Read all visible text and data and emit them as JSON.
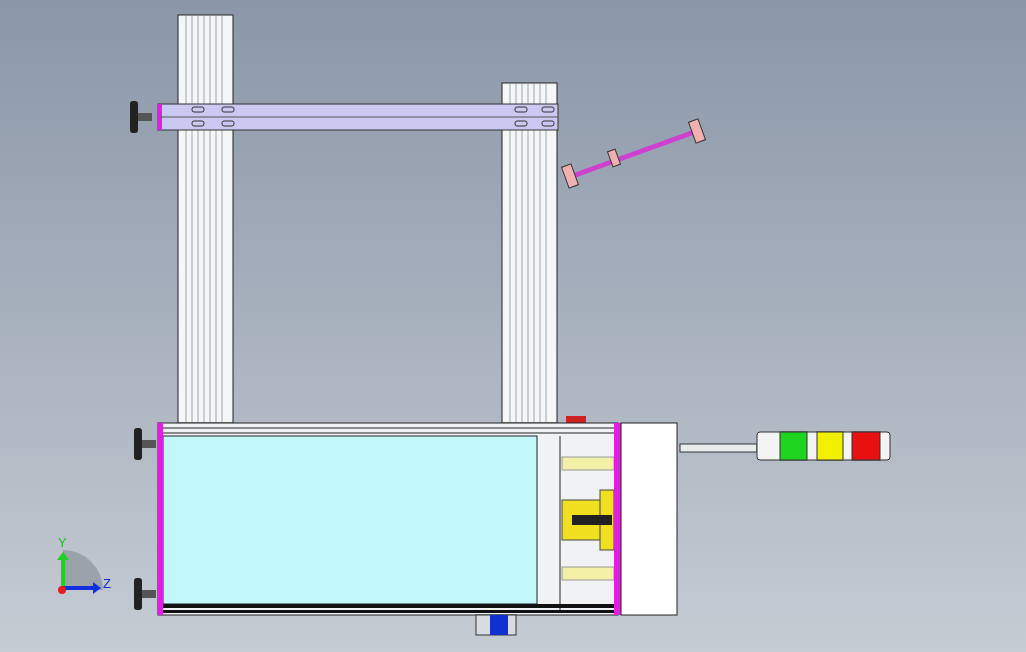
{
  "viewport": {
    "triad": {
      "axes": [
        {
          "kind": "y",
          "label": "Y"
        },
        {
          "kind": "z",
          "label": "Z"
        }
      ]
    },
    "signal_tower": {
      "lamps": [
        {
          "color": "#1fd41f"
        },
        {
          "color": "#f0f000"
        },
        {
          "color": "#e81010"
        }
      ]
    }
  }
}
